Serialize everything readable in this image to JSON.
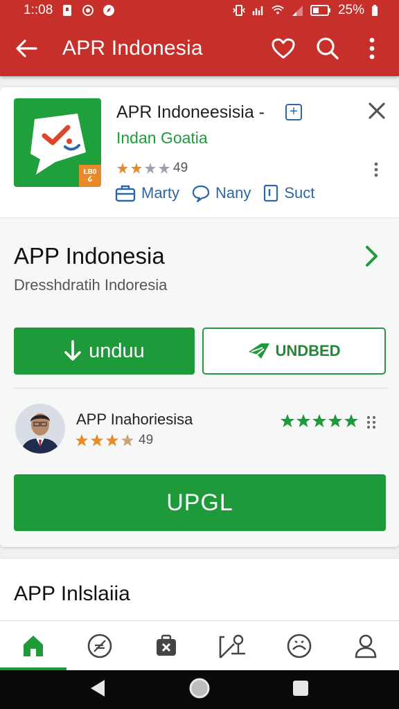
{
  "status_bar": {
    "time": "1::08",
    "battery": "25%"
  },
  "app_bar": {
    "title": "APR Indonesia",
    "back_icon": "arrow-left-icon",
    "favorite_icon": "heart-icon",
    "search_icon": "search-icon",
    "more_icon": "more-vertical-icon"
  },
  "app_card": {
    "app_name": "APR Indoneesisia -",
    "developer": "Indan Goatia",
    "rating_count": "49",
    "icon_badge": "ŁB0 ໒",
    "meta": [
      {
        "icon": "briefcase-icon",
        "label": "Marty"
      },
      {
        "icon": "chat-bubble-icon",
        "label": "Nany"
      },
      {
        "icon": "bracket-icon",
        "label": "Suct"
      }
    ]
  },
  "details": {
    "headline": "APP Indonesia",
    "subline": "Dresshdratih Indoresia",
    "download_button": "unduu",
    "secondary_button": "UNDBED",
    "reviewer_name": "APP Inahoriesisa",
    "reviewer_rating_count": "49",
    "primary_button": "UPGL"
  },
  "section2": {
    "heading": "APP Inlslaiia"
  },
  "colors": {
    "brand_red": "#c62f2a",
    "accent_green": "#1e9a3a",
    "link_blue": "#2a66a8",
    "star_orange": "#e8892a"
  }
}
